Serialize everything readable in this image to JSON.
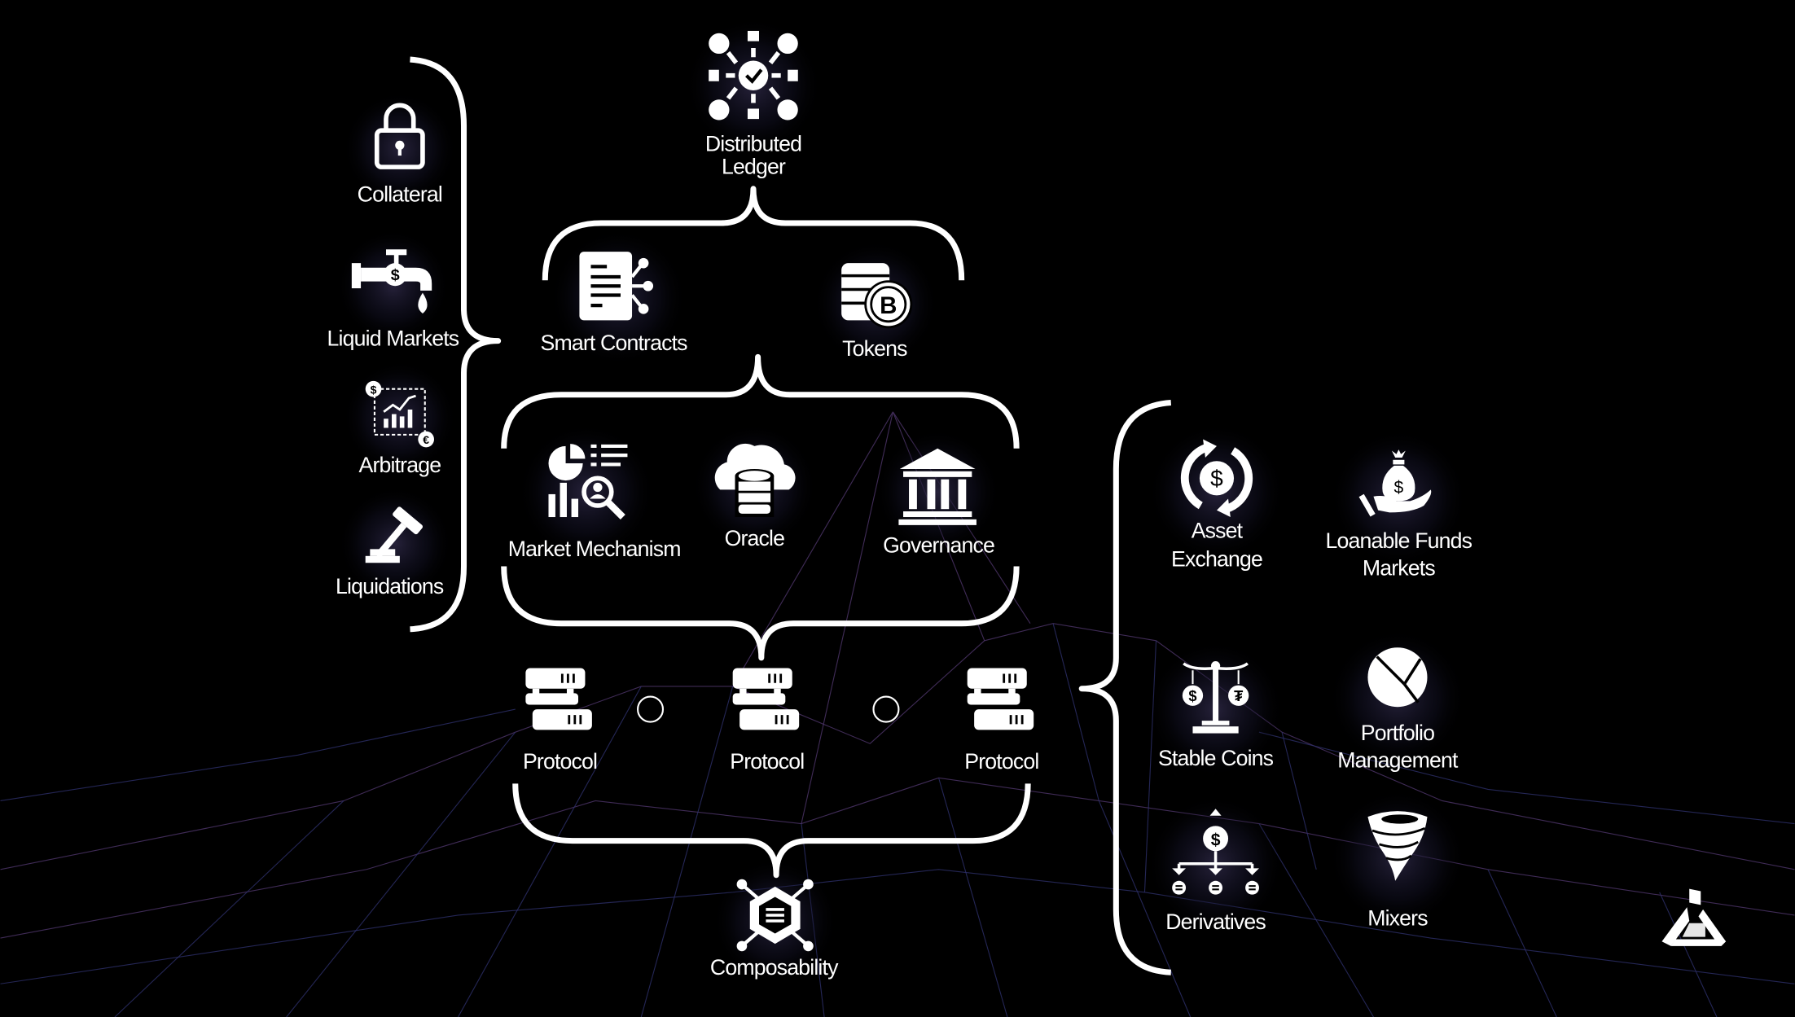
{
  "diagram": {
    "top": {
      "label_line1": "Distributed",
      "label_line2": "Ledger",
      "icon": "distributed-network-check-icon"
    },
    "layer1": [
      {
        "label": "Smart Contracts",
        "icon": "document-nodes-icon"
      },
      {
        "label": "Tokens",
        "icon": "coin-stack-bitcoin-icon"
      }
    ],
    "layer2": [
      {
        "label": "Market Mechanism",
        "icon": "chart-magnifier-icon"
      },
      {
        "label": "Oracle",
        "icon": "cloud-database-icon"
      },
      {
        "label": "Governance",
        "icon": "bank-building-icon"
      }
    ],
    "protocols": [
      {
        "label": "Protocol",
        "icon": "server-icon"
      },
      {
        "label": "Protocol",
        "icon": "server-icon"
      },
      {
        "label": "Protocol",
        "icon": "server-icon"
      }
    ],
    "bottom": {
      "label": "Composability",
      "icon": "hexagon-network-icon"
    },
    "left": [
      {
        "label": "Collateral",
        "icon": "padlock-icon"
      },
      {
        "label": "Liquid Markets",
        "icon": "faucet-dollar-icon"
      },
      {
        "label": "Arbitrage",
        "icon": "currency-chart-icon"
      },
      {
        "label": "Liquidations",
        "icon": "gavel-icon"
      }
    ],
    "right": [
      {
        "label_line1": "Asset",
        "label_line2": "Exchange",
        "icon": "dollar-exchange-icon"
      },
      {
        "label_line1": "Loanable Funds",
        "label_line2": "Markets",
        "icon": "money-bag-hand-icon"
      },
      {
        "label_line1": "Stable Coins",
        "label_line2": "",
        "icon": "balance-scale-icon"
      },
      {
        "label_line1": "Portfolio",
        "label_line2": "Management",
        "icon": "pie-chart-icon"
      },
      {
        "label_line1": "Derivatives",
        "label_line2": "",
        "icon": "dollar-split-icon"
      },
      {
        "label_line1": "Mixers",
        "label_line2": "",
        "icon": "tornado-icon"
      }
    ],
    "colors": {
      "background": "#000000",
      "foreground": "#ffffff",
      "mesh": "#5a3d7a"
    }
  }
}
